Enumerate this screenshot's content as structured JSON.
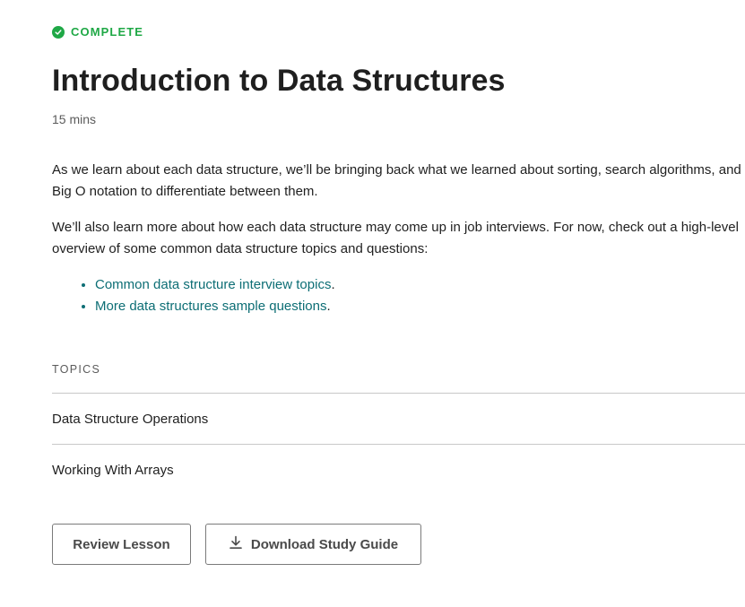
{
  "lesson": {
    "status": "COMPLETE",
    "title": "Introduction to Data Structures",
    "duration": "15 mins",
    "paragraphs": [
      "As we learn about each data structure, we’ll be bringing back what we learned about sorting, search algorithms, and Big O notation to differentiate between them.",
      "We’ll also learn more about how each data structure may come up in job interviews. For now, check out a high-level overview of some common data structure topics and questions:"
    ],
    "links": [
      {
        "label": "Common data structure interview topics",
        "suffix": "."
      },
      {
        "label": "More data structures sample questions",
        "suffix": "."
      }
    ]
  },
  "topics": {
    "heading": "TOPICS",
    "items": [
      {
        "label": "Data Structure Operations"
      },
      {
        "label": "Working With Arrays"
      }
    ]
  },
  "actions": {
    "review_label": "Review Lesson",
    "download_label": "Download Study Guide"
  },
  "icons": {
    "status": "check-circle-icon",
    "download": "download-icon"
  },
  "colors": {
    "complete": "#1fa846",
    "link": "#0d6e75",
    "text": "#1f1f1f"
  }
}
